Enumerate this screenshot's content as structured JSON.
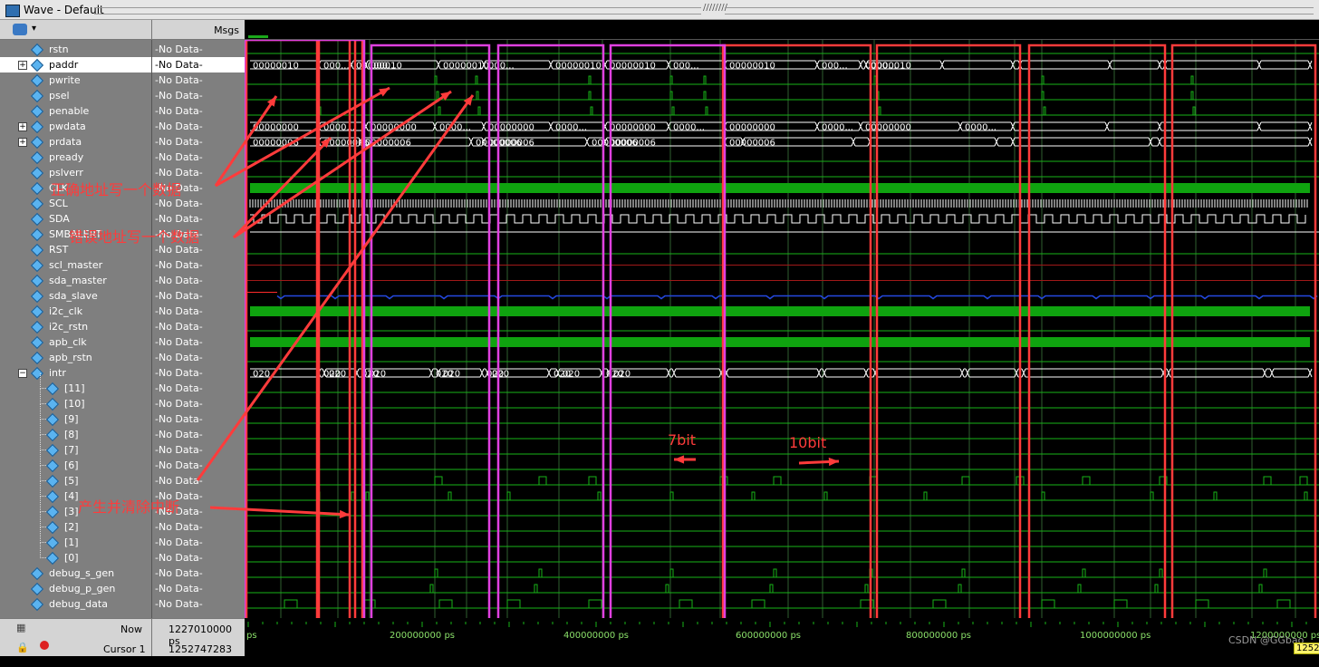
{
  "window": {
    "title": "Wave - Default"
  },
  "header": {
    "msgs_label": "Msgs"
  },
  "signals": [
    {
      "name": "rstn",
      "value": "-No Data-"
    },
    {
      "name": "paddr",
      "value": "-No Data-",
      "expandable": true,
      "selected": true
    },
    {
      "name": "pwrite",
      "value": "-No Data-"
    },
    {
      "name": "psel",
      "value": "-No Data-"
    },
    {
      "name": "penable",
      "value": "-No Data-"
    },
    {
      "name": "pwdata",
      "value": "-No Data-",
      "expandable": true
    },
    {
      "name": "prdata",
      "value": "-No Data-",
      "expandable": true
    },
    {
      "name": "pready",
      "value": "-No Data-"
    },
    {
      "name": "pslverr",
      "value": "-No Data-"
    },
    {
      "name": "CLK",
      "value": "-No Data-"
    },
    {
      "name": "SCL",
      "value": "-No Data-"
    },
    {
      "name": "SDA",
      "value": "-No Data-"
    },
    {
      "name": "SMBALERT",
      "value": "-No Data-"
    },
    {
      "name": "RST",
      "value": "-No Data-"
    },
    {
      "name": "scl_master",
      "value": "-No Data-"
    },
    {
      "name": "sda_master",
      "value": "-No Data-"
    },
    {
      "name": "sda_slave",
      "value": "-No Data-"
    },
    {
      "name": "i2c_clk",
      "value": "-No Data-"
    },
    {
      "name": "i2c_rstn",
      "value": "-No Data-"
    },
    {
      "name": "apb_clk",
      "value": "-No Data-"
    },
    {
      "name": "apb_rstn",
      "value": "-No Data-"
    },
    {
      "name": "intr",
      "value": "-No Data-",
      "expandable": true,
      "expanded": true
    },
    {
      "name": "[11]",
      "value": "-No Data-",
      "child": true
    },
    {
      "name": "[10]",
      "value": "-No Data-",
      "child": true
    },
    {
      "name": "[9]",
      "value": "-No Data-",
      "child": true
    },
    {
      "name": "[8]",
      "value": "-No Data-",
      "child": true
    },
    {
      "name": "[7]",
      "value": "-No Data-",
      "child": true
    },
    {
      "name": "[6]",
      "value": "-No Data-",
      "child": true
    },
    {
      "name": "[5]",
      "value": "-No Data-",
      "child": true
    },
    {
      "name": "[4]",
      "value": "-No Data-",
      "child": true
    },
    {
      "name": "[3]",
      "value": "-No Data-",
      "child": true
    },
    {
      "name": "[2]",
      "value": "-No Data-",
      "child": true
    },
    {
      "name": "[1]",
      "value": "-No Data-",
      "child": true
    },
    {
      "name": "[0]",
      "value": "-No Data-",
      "child": true
    },
    {
      "name": "debug_s_gen",
      "value": "-No Data-"
    },
    {
      "name": "debug_p_gen",
      "value": "-No Data-"
    },
    {
      "name": "debug_data",
      "value": "-No Data-"
    }
  ],
  "bus_values": {
    "paddr": [
      "00000010",
      "000...",
      "00000010",
      "000...",
      "00000010",
      "000...",
      "00000010",
      "00000010",
      "000...",
      "00000010",
      "000...",
      "00000010",
      "000..."
    ],
    "pwdata": [
      "00000000",
      "0000...",
      "00000000",
      "0000...",
      "00000000",
      "0000...",
      "00000000",
      "0000...",
      "00000000",
      "0000...",
      "00000000",
      "0000..."
    ],
    "prdata": [
      "00000006",
      "00000006",
      "00000006",
      "00000006",
      "00000006",
      "00000006",
      "00000006",
      "00000006"
    ],
    "intr": [
      "020",
      "020",
      "020",
      "020",
      "020",
      "020",
      "020",
      "020",
      "020",
      "020",
      "020",
      "020",
      "020"
    ]
  },
  "status": {
    "now_label": "Now",
    "now_value": "1227010000 ps",
    "cursor_label": "Cursor 1",
    "cursor_value": "1252747283 ps",
    "cursor_flag": "1252"
  },
  "timeline": {
    "start_label": "ps",
    "labels": [
      "200000000 ps",
      "400000000 ps",
      "600000000 ps",
      "800000000 ps",
      "1000000000 ps",
      "1200000000 ps"
    ]
  },
  "annotations": {
    "write_correct": "正确地址写一个数据",
    "write_wrong": "错误地址写一个数据",
    "intr_gen_clear": "产生并清除中断",
    "bit7": "7bit",
    "bit10": "10bit"
  },
  "watermark": "CSDN @GGbao",
  "colors": {
    "wave_green": "#18b318",
    "wave_white": "#ffffff",
    "wave_blue": "#2448e0",
    "wave_red": "#ff2a2a",
    "box_red": "#ff3b3b",
    "box_magenta": "#e040e0",
    "annot_red": "#ff3b3b"
  },
  "icons": [
    "wave-window-icon",
    "diamond-signal-icon",
    "expand-plus-icon",
    "collapse-minus-icon",
    "lock-icon",
    "wrench-icon",
    "close-icon"
  ]
}
